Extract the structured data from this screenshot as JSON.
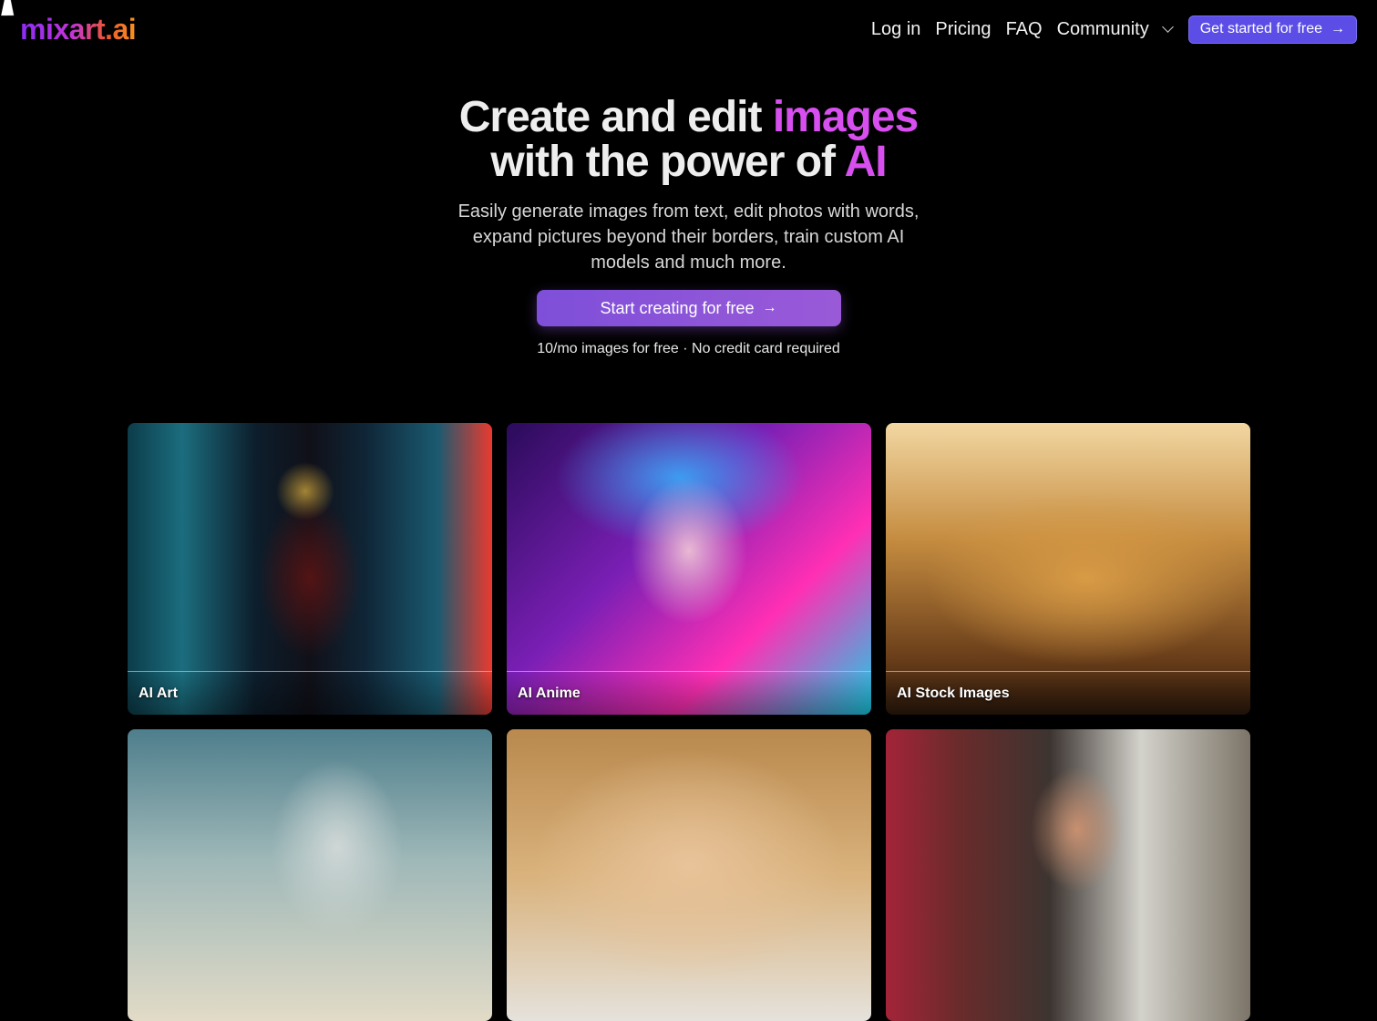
{
  "header": {
    "logo": "mixart.ai",
    "nav": {
      "login": "Log in",
      "pricing": "Pricing",
      "faq": "FAQ",
      "community": "Community"
    },
    "cta": "Get started for free"
  },
  "hero": {
    "title_line1_plain": "Create and edit ",
    "title_line1_highlight": "images",
    "title_line2_plain": "with the power of ",
    "title_line2_highlight": "AI",
    "subtitle": "Easily generate images from text, edit photos with words, expand pictures beyond their borders, train custom AI models and much more.",
    "cta": "Start creating for free",
    "note": "10/mo images for free · No credit card required"
  },
  "gallery": {
    "cards": [
      {
        "label": "AI Art"
      },
      {
        "label": "AI Anime"
      },
      {
        "label": "AI Stock Images"
      },
      {
        "label": ""
      },
      {
        "label": ""
      },
      {
        "label": ""
      }
    ]
  },
  "colors": {
    "accent": "#5b4de6",
    "highlight": "#d84ff0",
    "background": "#000000"
  },
  "icons": {
    "arrow": "arrow-right-icon",
    "dropdown": "chevron-down-icon"
  }
}
